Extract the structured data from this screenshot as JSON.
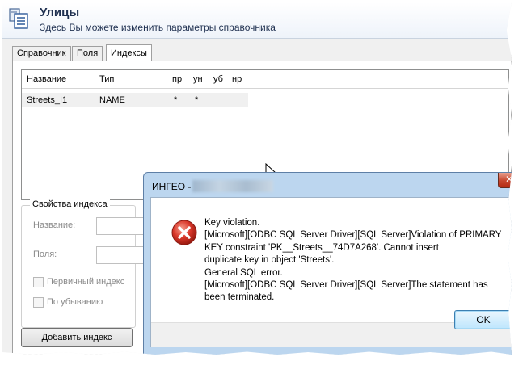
{
  "app": {
    "title": "Улицы",
    "subtitle": "Здесь Вы можете изменить параметры справочника",
    "icon": "table-document-icon"
  },
  "tabs": [
    {
      "label": "Справочник",
      "active": false
    },
    {
      "label": "Поля",
      "active": false
    },
    {
      "label": "Индексы",
      "active": true
    }
  ],
  "grid": {
    "columns": [
      "Название",
      "Тип",
      "пр",
      "ун",
      "уб",
      "нр"
    ],
    "rows": [
      {
        "name": "Streets_I1",
        "type": "NAME",
        "pr": "*",
        "un": "*",
        "ub": "",
        "nr": ""
      }
    ]
  },
  "index_properties": {
    "legend": "Свойства индекса",
    "name_label": "Название:",
    "fields_label": "Поля:",
    "primary_label": "Первичный индекс",
    "descending_label": "По убыванию"
  },
  "add_button": "Добавить индекс",
  "dialog": {
    "title": "ИНГЕО -",
    "close_icon": "close-icon",
    "error_icon": "error-icon",
    "message_lines": [
      "Key violation.",
      "[Microsoft][ODBC SQL Server Driver][SQL Server]Violation of PRIMARY",
      "KEY constraint 'PK__Streets__74D7A268'. Cannot insert",
      "duplicate key in object 'Streets'.",
      "General SQL error.",
      "[Microsoft][ODBC SQL Server Driver][SQL Server]The statement has",
      "been terminated."
    ],
    "ok_label": "OK"
  },
  "colors": {
    "dialog_frame": "#bcd6ef",
    "close_button": "#c6452c",
    "error_red": "#d9372a",
    "title_text": "#1f3050"
  }
}
